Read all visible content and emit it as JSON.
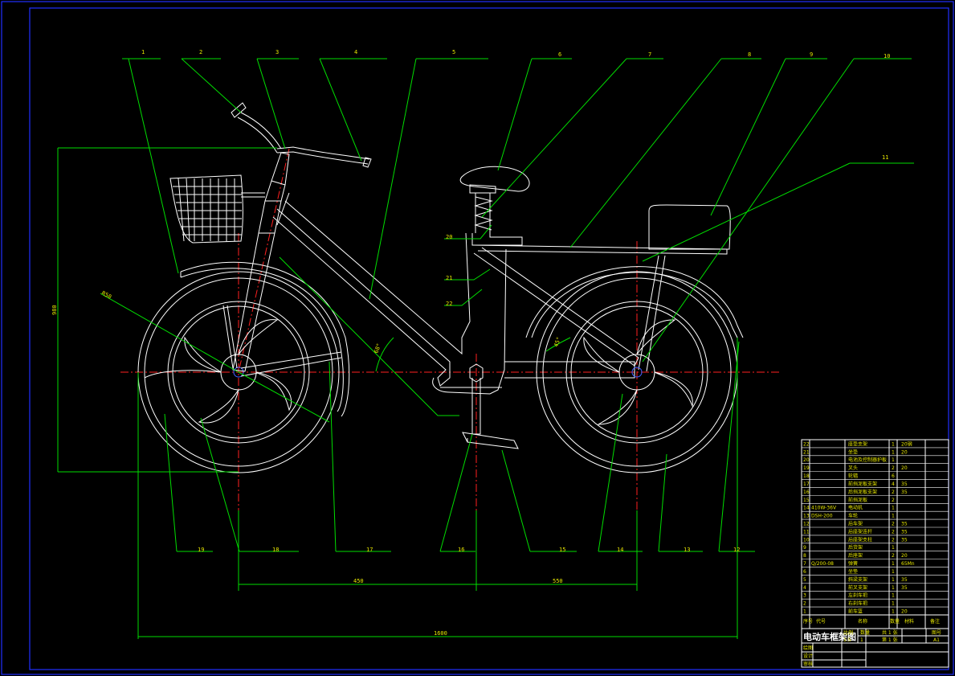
{
  "title_block": {
    "title": "电动车框架图",
    "scale_label": "比例",
    "scale_value": "1:5",
    "qty_label": "数量",
    "qty_value": "1",
    "sheet_total": "共 1 张",
    "sheet_index": "第 1 张",
    "drawing_label": "图号",
    "drawing_no": "A1",
    "draw_label": "绘图",
    "design_label": "设计",
    "review_label": "审核"
  },
  "bom_header": [
    "序号",
    "代号",
    "名称",
    "数量",
    "材料",
    "备注"
  ],
  "bom_rows": [
    {
      "no": "22",
      "code": "",
      "name": "座垫支架",
      "qty": "1",
      "mat": "20钢"
    },
    {
      "no": "21",
      "code": "",
      "name": "坐垫",
      "qty": "1",
      "mat": "20"
    },
    {
      "no": "20",
      "code": "",
      "name": "电池及控制器护板",
      "qty": "1",
      "mat": ""
    },
    {
      "no": "19",
      "code": "",
      "name": "叉头",
      "qty": "2",
      "mat": "20"
    },
    {
      "no": "18",
      "code": "",
      "name": "轮辐",
      "qty": "6",
      "mat": ""
    },
    {
      "no": "17",
      "code": "",
      "name": "前挡泥板支架",
      "qty": "4",
      "mat": "35"
    },
    {
      "no": "16",
      "code": "",
      "name": "后挡泥板支架",
      "qty": "2",
      "mat": "35"
    },
    {
      "no": "15",
      "code": "",
      "name": "前挡泥板",
      "qty": "2",
      "mat": ""
    },
    {
      "no": "14",
      "code": "410W-36V",
      "name": "电动机",
      "qty": "1",
      "mat": ""
    },
    {
      "no": "13",
      "code": "DSH-200",
      "name": "车轮",
      "qty": "1",
      "mat": ""
    },
    {
      "no": "12",
      "code": "",
      "name": "后车架",
      "qty": "2",
      "mat": "35"
    },
    {
      "no": "11",
      "code": "",
      "name": "后座架连杆",
      "qty": "2",
      "mat": "35"
    },
    {
      "no": "10",
      "code": "",
      "name": "后座架支柱",
      "qty": "2",
      "mat": "35"
    },
    {
      "no": "9",
      "code": "",
      "name": "后货架",
      "qty": "1",
      "mat": ""
    },
    {
      "no": "8",
      "code": "",
      "name": "后座架",
      "qty": "2",
      "mat": "20"
    },
    {
      "no": "7",
      "code": "Q/200-08",
      "name": "弹簧",
      "qty": "1",
      "mat": "65Mn"
    },
    {
      "no": "6",
      "code": "",
      "name": "坐垫",
      "qty": "1",
      "mat": ""
    },
    {
      "no": "5",
      "code": "",
      "name": "斜梁支架",
      "qty": "1",
      "mat": "35"
    },
    {
      "no": "4",
      "code": "",
      "name": "前叉支架",
      "qty": "1",
      "mat": "35"
    },
    {
      "no": "3",
      "code": "",
      "name": "左刹车把",
      "qty": "1",
      "mat": ""
    },
    {
      "no": "2",
      "code": "",
      "name": "右刹车把",
      "qty": "1",
      "mat": ""
    },
    {
      "no": "1",
      "code": "",
      "name": "前车篮",
      "qty": "1",
      "mat": "20"
    }
  ],
  "part_labels": {
    "top": [
      "1",
      "2",
      "3",
      "4",
      "5",
      "6",
      "7",
      "8",
      "9",
      "10",
      "11"
    ],
    "left": [
      "20",
      "21",
      "22"
    ],
    "bottom": [
      "19",
      "18",
      "17",
      "16",
      "15",
      "14",
      "13",
      "12"
    ]
  },
  "dimensions": {
    "wheelbase_left": "450",
    "wheelbase_right": "550",
    "overall_length": "1600",
    "overall_height": "980",
    "wheel_radius": "R50",
    "angle_front": "68°",
    "angle_rear": "45°"
  },
  "colors": {
    "outline": "#ffffff",
    "leader": "#00dd00",
    "centerline": "#ff2020",
    "border": "#2030ff",
    "text": "#e6e600"
  }
}
